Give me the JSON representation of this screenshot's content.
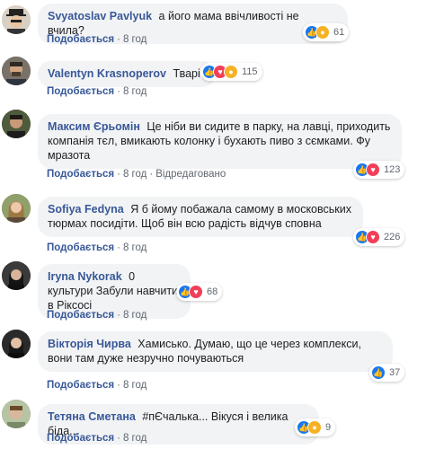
{
  "like_label": "Подобається",
  "comments": [
    {
      "author": "Svyatoslav Pavlyuk",
      "text": "а його мама ввічливості не вчила?",
      "time": "8 год",
      "reactions": [
        "like-icon",
        "wow-icon"
      ],
      "count": "61"
    },
    {
      "author": "Valentyn Krasnoperov",
      "text": "Тварі",
      "time": "8 год",
      "reactions": [
        "like-icon",
        "love-icon",
        "haha-icon"
      ],
      "count": "115"
    },
    {
      "author": "Максим Єрьомін",
      "text": "Це ніби ви сидите в парку, на лавці, приходить компанія тєл, вмикають колонку і бухають пиво з сємками. Фу мразота",
      "time": "8 год",
      "edited": "Відредаговано",
      "reactions": [
        "like-icon",
        "love-icon"
      ],
      "count": "123"
    },
    {
      "author": "Sofiya Fedyna",
      "text": "Я б йому побажала самому в московських тюрмах посидіти. Щоб він всю радість відчув сповна",
      "time": "8 год",
      "reactions": [
        "like-icon",
        "love-icon"
      ],
      "count": "226"
    },
    {
      "author": "Iryna Nykorak",
      "text": "0 культури Забули навчити в Ріксосі",
      "time": "8 год",
      "reactions": [
        "like-icon",
        "love-icon"
      ],
      "count": "68"
    },
    {
      "author": "Вікторія Чирва",
      "text": "Хамисько. Думаю, що це через комплекси, вони там дуже незручно почуваються",
      "time": "8 год",
      "reactions": [
        "like-icon"
      ],
      "count": "37"
    },
    {
      "author": "Тетяна Сметана",
      "text": "#пЄчалька... Вікуся і велика біда...",
      "time": "8 год",
      "reactions": [
        "like-icon",
        "haha-icon"
      ],
      "count": "9"
    }
  ],
  "colors": {
    "link": "#385898",
    "bubble": "#f2f3f5",
    "like": "#1877f2",
    "love": "#f33e58",
    "wow": "#f7b125"
  }
}
